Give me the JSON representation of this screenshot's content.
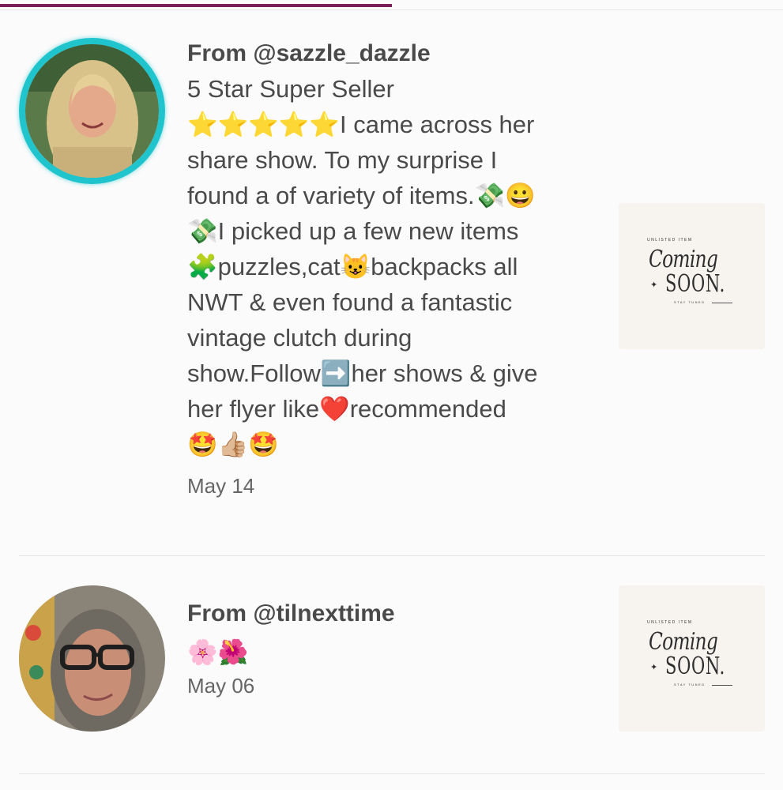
{
  "progress": {
    "fraction": 0.5,
    "color": "#7a1f5c"
  },
  "reviews": [
    {
      "from": "From @sazzle_dazzle",
      "title": "5 Star Super Seller",
      "body": "⭐⭐⭐⭐⭐I came across her\nshare show. To my surprise I\nfound a of variety of items.💸😀\n💸I picked up a few new items\n🧩puzzles,cat😺backpacks all\nNWT & even found a fantastic\nvintage clutch during\nshow.Follow➡️her shows & give\nher flyer like❤️recommended\n🤩👍🏼🤩",
      "date": "May 14",
      "avatar_ring_color": "#20c4cc",
      "thumbnail": {
        "small_label": "UNLISTED ITEM",
        "coming": "Coming",
        "soon": "SOON.",
        "tagline": "STAY TUNED"
      }
    },
    {
      "from": "From @tilnexttime",
      "body": "🌸🌺",
      "date": "May 06",
      "thumbnail": {
        "small_label": "UNLISTED ITEM",
        "coming": "Coming",
        "soon": "SOON.",
        "tagline": "STAY TUNED"
      }
    }
  ]
}
